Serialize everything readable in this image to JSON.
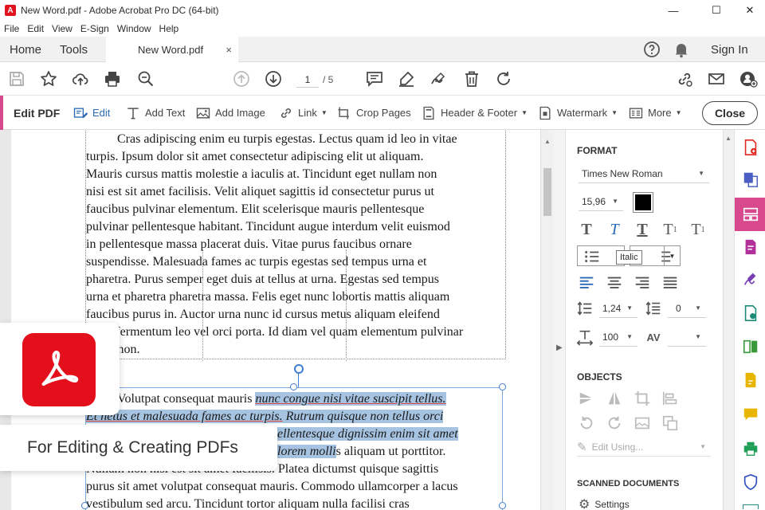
{
  "window": {
    "title": "New  Word.pdf - Adobe Acrobat Pro DC (64-bit)",
    "minimize": "—",
    "maximize": "☐",
    "close": "✕"
  },
  "menu": [
    "File",
    "Edit",
    "View",
    "E-Sign",
    "Window",
    "Help"
  ],
  "tabs": {
    "home": "Home",
    "tools": "Tools",
    "doc": "New  Word.pdf",
    "doc_close": "×",
    "sign_in": "Sign In"
  },
  "toolbar": {
    "page_current": "1",
    "page_total": "/ 5"
  },
  "editbar": {
    "title": "Edit PDF",
    "edit": "Edit",
    "add_text": "Add Text",
    "add_image": "Add Image",
    "link": "Link",
    "crop": "Crop Pages",
    "header_footer": "Header & Footer",
    "watermark": "Watermark",
    "more": "More",
    "close": "Close"
  },
  "document": {
    "para1": [
      "Cras adipiscing enim eu turpis egestas. Lectus quam id leo in vitae",
      "turpis. Ipsum dolor sit amet consectetur adipiscing elit ut aliquam.",
      "Mauris cursus mattis molestie a iaculis at. Tincidunt eget nullam non",
      "nisi est sit amet facilisis. Velit aliquet sagittis id consectetur purus ut",
      "faucibus pulvinar elementum. Elit scelerisque mauris pellentesque",
      "pulvinar pellentesque habitant. Tincidunt augue interdum velit euismod",
      "in pellentesque massa placerat duis. Vitae purus faucibus ornare",
      "suspendisse. Malesuada fames ac turpis egestas sed tempus urna et",
      "pharetra. Purus semper eget duis at tellus at urna. Egestas sed tempus",
      "urna et pharetra pharetra massa. Felis eget nunc lobortis mattis aliquam",
      "faucibus purus in. Auctor urna nunc id cursus metus aliquam eleifend",
      "mi in fermentum leo vel orci porta. Id diam vel quam elementum pulvinar",
      "etiam non."
    ],
    "para2_line1_plain": "Volutpat consequat mauris ",
    "para2_line1_sel": "nunc congue nisi vitae suscipit tellus.",
    "para2_line2_sel_a": "Et   netus et malesuada fames ac turpis.",
    "para2_line2_sel_b": " Rutrum quisque non tellus orci",
    "para2_line3_sel": "ellentesque dignissim enim sit amet",
    "para2_line4_sel": "lorem molli",
    "para2_line4_plain": "s aliquam ut porttitor.",
    "para2_line5": "Nullam non nisi est sit amet facilisis. Platea dictumst quisque sagittis",
    "para2_line6": "purus sit amet volutpat consequat mauris. Commodo ullamcorper a lacus",
    "para2_line7": "vestibulum sed arcu. Tincidunt tortor aliquam nulla facilisi cras"
  },
  "panel": {
    "format_heading": "FORMAT",
    "font_family": "Times New Roman",
    "font_size": "15,96",
    "text_color": "#000000",
    "tooltip": "Italic",
    "line_spacing": "1,24",
    "para_spacing": "0",
    "h_scale": "100",
    "char_spacing": "",
    "objects_heading": "OBJECTS",
    "edit_using": "Edit Using...",
    "scanned_heading": "SCANNED DOCUMENTS",
    "settings": "Settings"
  },
  "overlay": {
    "banner_text": "For Editing & Creating PDFs"
  },
  "colors": {
    "accent_pink": "#d7488d",
    "acrobat_red": "#e3101b",
    "edit_blue": "#2a6ab5",
    "selection": "#a6c4e2"
  }
}
